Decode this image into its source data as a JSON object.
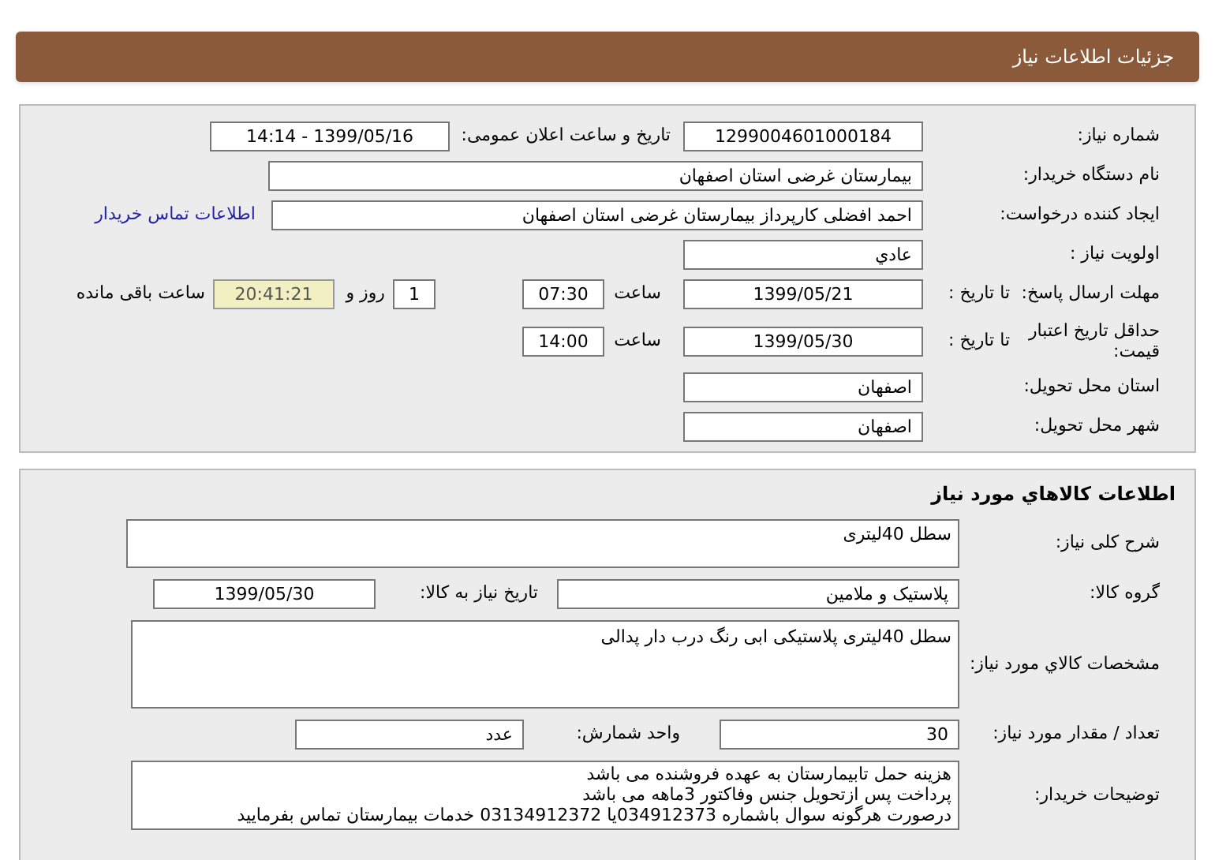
{
  "header": {
    "title": "جزئیات اطلاعات نیاز"
  },
  "need": {
    "number_label": "شماره نیاز:",
    "number": "1299004601000184",
    "announce_label": "تاریخ و ساعت اعلان عمومی:",
    "announce": "1399/05/16 - 14:14",
    "buyer_label": "نام دستگاه خریدار:",
    "buyer": "بیمارستان غرضی استان اصفهان",
    "creator_label": "ایجاد کننده درخواست:",
    "creator": "احمد افضلی کارپرداز بیمارستان غرضی استان اصفهان",
    "contact_link": "اطلاعات تماس خریدار",
    "priority_label": "اولویت نیاز :",
    "priority": "عادي",
    "deadline_label": "مهلت ارسال پاسخ:",
    "deadline_to": "تا تاریخ :",
    "deadline_date": "1399/05/21",
    "deadline_time_label": "ساعت",
    "deadline_time": "07:30",
    "days": "1",
    "days_label": "روز و",
    "remaining": "20:41:21",
    "remaining_label": "ساعت باقی مانده",
    "validity_label": "حداقل تاریخ اعتبار قیمت:",
    "validity_to": "تا تاریخ :",
    "validity_date": "1399/05/30",
    "validity_time_label": "ساعت",
    "validity_time": "14:00",
    "province_label": "استان محل تحویل:",
    "province": "اصفهان",
    "city_label": "شهر محل تحویل:",
    "city": "اصفهان"
  },
  "goods": {
    "title": "اطلاعات کالاهاي مورد نیاز",
    "summary_label": "شرح کلی نیاز:",
    "summary": "سطل 40لیتری",
    "group_label": "گروه کالا:",
    "group": "پلاستیک و ملامین",
    "need_date_label": "تاریخ نیاز به کالا:",
    "need_date": "1399/05/30",
    "spec_label": "مشخصات کالاي مورد نیاز:",
    "spec": "سطل 40لیتری پلاستیکی ابی رنگ درب دار پدالی",
    "qty_label": "تعداد / مقدار مورد نیاز:",
    "qty": "30",
    "unit_label": "واحد شمارش:",
    "unit": "عدد",
    "notes_label": "توضیحات خریدار:",
    "notes": [
      "هزینه حمل تابیمارستان به عهده فروشنده می باشد",
      "پرداخت پس ازتحویل جنس وفاکتور 3ماهه می باشد",
      "درصورت هرگونه سوال باشماره 034912373یا 03134912372 خدمات بیمارستان تماس بفرمایید"
    ]
  }
}
